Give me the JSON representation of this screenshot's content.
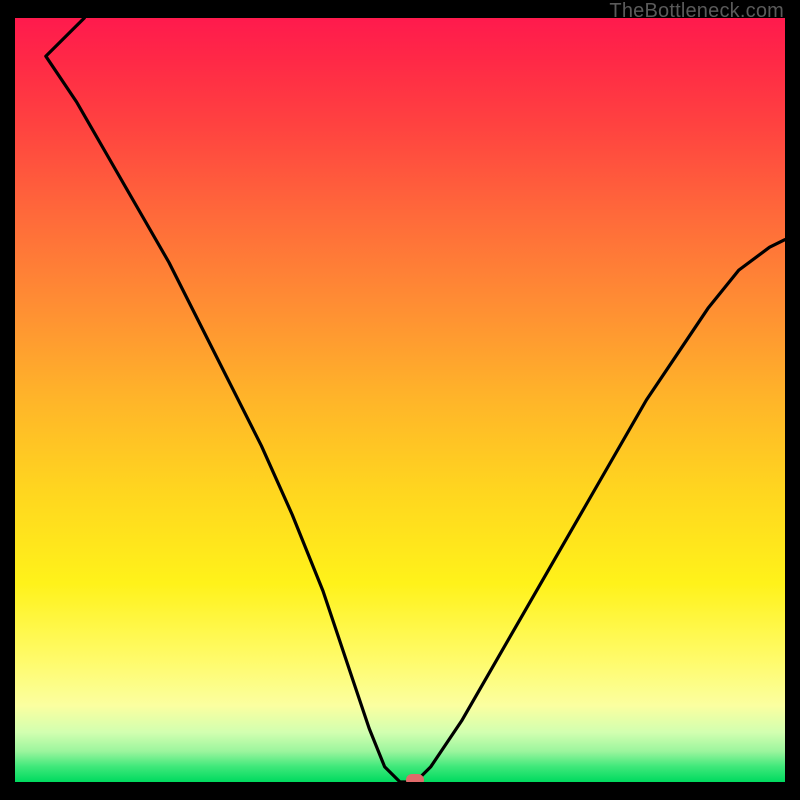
{
  "watermark": "TheBottleneck.com",
  "colors": {
    "frame": "#000000",
    "curve": "#000000",
    "marker": "#e06a6a",
    "gradient_stops": [
      "#ff1a4d",
      "#ff2a46",
      "#ff4240",
      "#ff6a3a",
      "#ff8f33",
      "#ffb529",
      "#ffd61f",
      "#fff21a",
      "#fffb6a",
      "#fbffa0",
      "#d2ffb0",
      "#9bf59d",
      "#3fe87a",
      "#00da5f"
    ]
  },
  "chart_data": {
    "type": "line",
    "title": "",
    "xlabel": "",
    "ylabel": "",
    "xlim": [
      0,
      100
    ],
    "ylim": [
      0,
      100
    ],
    "grid": false,
    "legend": false,
    "description": "Bottleneck percentage (y, 0=green=no bottleneck, 100=red=severe) vs. hardware balance position (x). Curve drops steeply from left, reaches a flat minimum near x≈48–52, then rises more gently toward the right edge. Marker indicates current configuration at the minimum.",
    "x": [
      0,
      4,
      8,
      12,
      16,
      20,
      24,
      28,
      32,
      36,
      40,
      44,
      46,
      48,
      50,
      52,
      54,
      58,
      62,
      66,
      70,
      74,
      78,
      82,
      86,
      90,
      94,
      98,
      100
    ],
    "values": [
      100,
      95,
      89,
      82,
      75,
      68,
      60,
      52,
      44,
      35,
      25,
      13,
      7,
      2,
      0,
      0,
      2,
      8,
      15,
      22,
      29,
      36,
      43,
      50,
      56,
      62,
      67,
      70,
      71
    ],
    "marker": {
      "x": 52,
      "y": 0
    }
  }
}
